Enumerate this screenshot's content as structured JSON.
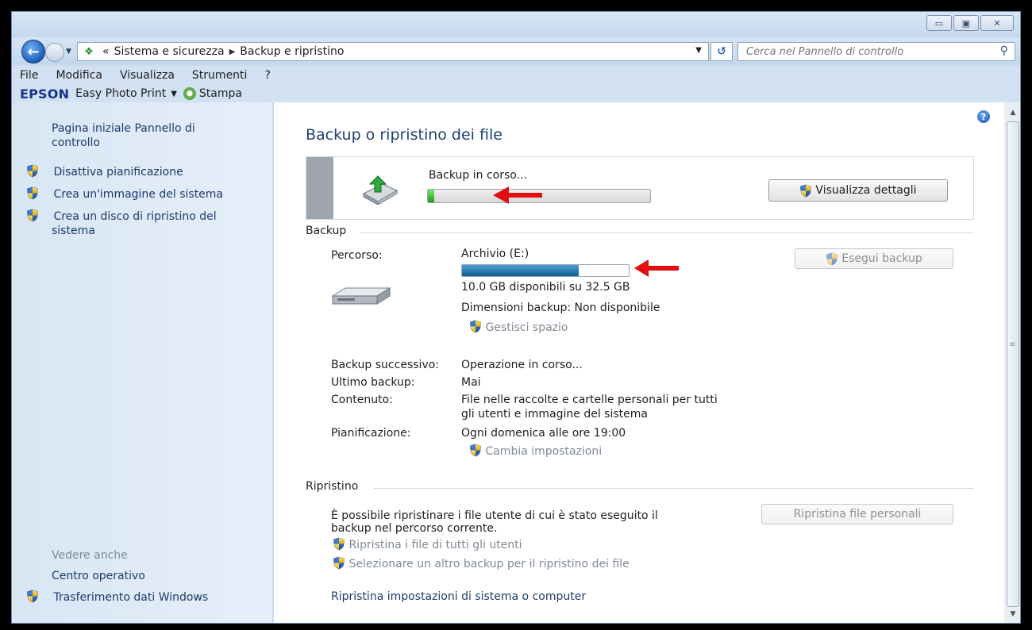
{
  "window": {
    "buttons": {
      "minimize": "▭",
      "maximize": "▣",
      "close": "✕"
    }
  },
  "navbar": {
    "breadcrumb_prefix": "«",
    "breadcrumb": [
      "Sistema e sicurezza",
      "Backup e ripristino"
    ],
    "search_placeholder": "Cerca nel Pannello di controllo"
  },
  "menu": [
    "File",
    "Modifica",
    "Visualizza",
    "Strumenti",
    "?"
  ],
  "epson_toolbar": {
    "logo": "EPSON",
    "product": "Easy Photo Print",
    "stampa": "Stampa"
  },
  "sidebar": {
    "home_link_line1": "Pagina iniziale Pannello di",
    "home_link_line2": "controllo",
    "items": [
      {
        "label": "Disattiva pianificazione"
      },
      {
        "label": "Crea un'immagine del sistema"
      },
      {
        "label_line1": "Crea un disco di ripristino del",
        "label_line2": "sistema"
      }
    ],
    "see_also": "Vedere anche",
    "see_also_items": [
      "Centro operativo",
      "Trasferimento dati Windows"
    ]
  },
  "main": {
    "title": "Backup o ripristino dei file",
    "status": {
      "text": "Backup in corso...",
      "progress_fraction": 0.03,
      "button": "Visualizza dettagli"
    },
    "backup": {
      "section_label": "Backup",
      "percorso_label": "Percorso:",
      "drive_name": "Archivio (E:)",
      "drive_used_fraction": 0.7,
      "free_space": "10.0 GB disponibili su 32.5 GB",
      "size": "Dimensioni backup: Non disponibile",
      "manage_link": "Gestisci spazio",
      "run_button": "Esegui backup",
      "details": [
        {
          "label": "Backup successivo:",
          "value": "Operazione in corso..."
        },
        {
          "label": "Ultimo backup:",
          "value": "Mai"
        },
        {
          "label": "Contenuto:",
          "value_line1": "File nelle raccolte e cartelle personali per tutti",
          "value_line2": "gli utenti e immagine del sistema"
        },
        {
          "label": "Pianificazione:",
          "value": "Ogni domenica alle ore 19:00"
        }
      ],
      "change_settings_link": "Cambia impostazioni"
    },
    "restore": {
      "section_label": "Ripristino",
      "desc_line1": "È possibile ripristinare i file utente di cui è stato eseguito il",
      "desc_line2": "backup nel percorso corrente.",
      "button": "Ripristina file personali",
      "link_all_users": "Ripristina i file di tutti gli utenti",
      "link_other_backup": "Selezionare un altro backup per il ripristino dei file",
      "link_system": "Ripristina impostazioni di sistema o computer"
    }
  },
  "colors": {
    "annotation_arrow": "#e01010",
    "link_blue": "#1e3a6c",
    "progress_green": "#1e9b17",
    "progress_blue": "#0f5d93"
  }
}
